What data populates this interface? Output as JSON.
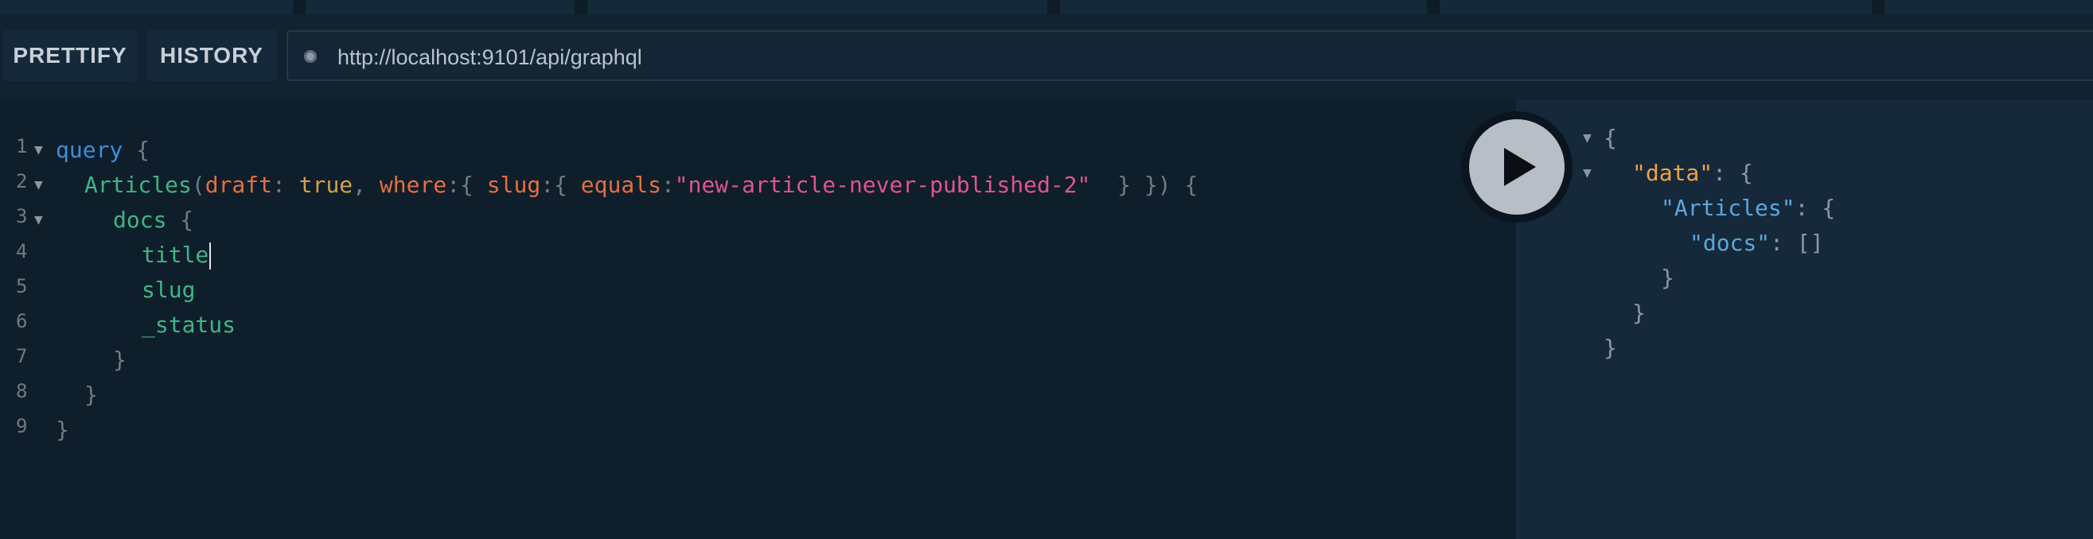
{
  "toolbar": {
    "prettify_label": "PRETTIFY",
    "history_label": "HISTORY",
    "url": "http://localhost:9101/api/graphql"
  },
  "editor": {
    "line_numbers": [
      "1",
      "2",
      "3",
      "4",
      "5",
      "6",
      "7",
      "8",
      "9"
    ],
    "lines": [
      {
        "segments": [
          [
            "k",
            "query"
          ],
          [
            "br",
            " {"
          ]
        ]
      },
      {
        "segments": [
          [
            "fd",
            "Articles"
          ],
          [
            "br",
            "("
          ],
          [
            "ar",
            "draft"
          ],
          [
            "br",
            ": "
          ],
          [
            "vb",
            "true"
          ],
          [
            "br",
            ", "
          ],
          [
            "ar",
            "where"
          ],
          [
            "br",
            ":{ "
          ],
          [
            "ar",
            "slug"
          ],
          [
            "br",
            ":{ "
          ],
          [
            "ar",
            "equals"
          ],
          [
            "br",
            ":"
          ],
          [
            "st",
            "\"new-article-never-published-2\""
          ],
          [
            "br",
            "  } }) {"
          ]
        ]
      },
      {
        "segments": [
          [
            "fd",
            "docs"
          ],
          [
            "br",
            " {"
          ]
        ]
      },
      {
        "segments": [
          [
            "fd",
            "title"
          ]
        ]
      },
      {
        "segments": [
          [
            "fd",
            "slug"
          ]
        ]
      },
      {
        "segments": [
          [
            "fd",
            "_status"
          ]
        ]
      },
      {
        "segments": [
          [
            "br",
            "}"
          ]
        ]
      },
      {
        "segments": [
          [
            "br",
            "}"
          ]
        ]
      },
      {
        "segments": [
          [
            "br",
            "}"
          ]
        ]
      }
    ]
  },
  "results": {
    "lines": [
      {
        "segments": [
          [
            "jp",
            "{"
          ]
        ]
      },
      {
        "segments": [
          [
            "jk",
            "\"data\""
          ],
          [
            "jp",
            ": {"
          ]
        ]
      },
      {
        "segments": [
          [
            "jk2",
            "\"Articles\""
          ],
          [
            "jp",
            ": {"
          ]
        ]
      },
      {
        "segments": [
          [
            "jk2",
            "\"docs\""
          ],
          [
            "jp",
            ": []"
          ]
        ]
      },
      {
        "segments": [
          [
            "jp",
            "}"
          ]
        ]
      },
      {
        "segments": [
          [
            "jp",
            "}"
          ]
        ]
      },
      {
        "segments": [
          [
            "jp",
            "}"
          ]
        ]
      }
    ]
  },
  "colors": {
    "background": "#0f202d",
    "keyword": "#3b8fd8",
    "field": "#3fb583",
    "argument": "#e46f3f",
    "string": "#e0558c",
    "json_key": "#f0a345"
  },
  "icons": {
    "run": "play-icon",
    "fold": "fold-arrow-icon",
    "status": "status-dot-icon"
  }
}
